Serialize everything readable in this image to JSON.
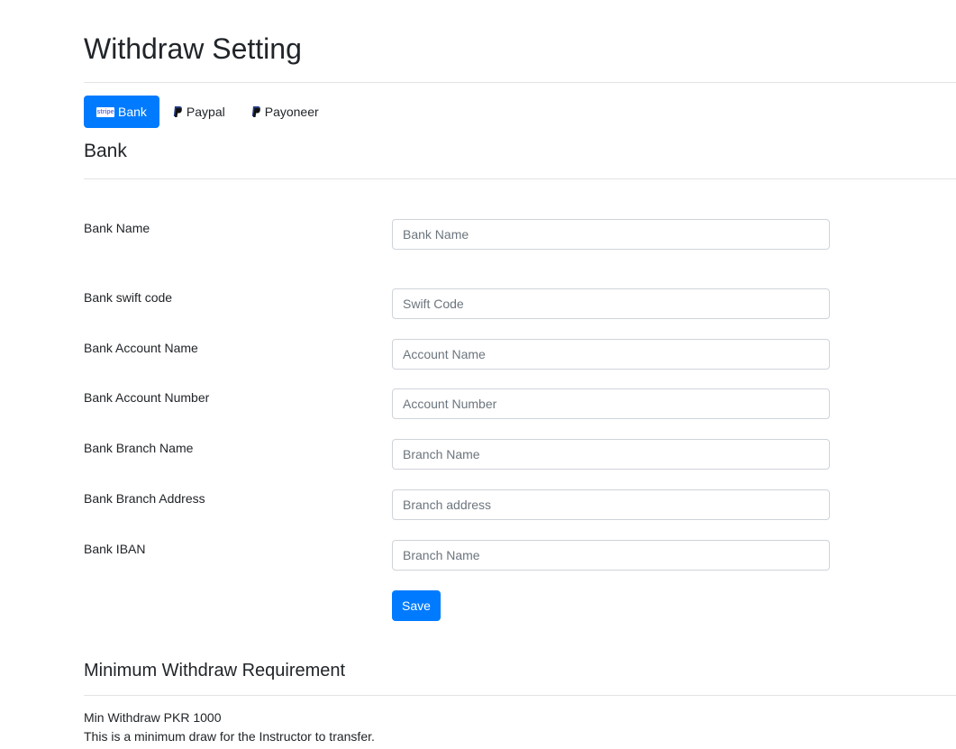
{
  "page": {
    "title": "Withdraw Setting"
  },
  "tabs": [
    {
      "label": "Bank",
      "icon": "stripe-icon",
      "active": true
    },
    {
      "label": "Paypal",
      "icon": "paypal-icon",
      "active": false
    },
    {
      "label": "Payoneer",
      "icon": "paypal-icon",
      "active": false
    }
  ],
  "stripe_badge": "stripe",
  "bank_section": {
    "title": "Bank",
    "fields": [
      {
        "label": "Bank Name",
        "placeholder": "Bank Name",
        "value": ""
      },
      {
        "label": "Bank swift code",
        "placeholder": "Swift Code",
        "value": ""
      },
      {
        "label": "Bank Account Name",
        "placeholder": "Account Name",
        "value": ""
      },
      {
        "label": "Bank Account Number",
        "placeholder": "Account Number",
        "value": ""
      },
      {
        "label": "Bank Branch Name",
        "placeholder": "Branch Name",
        "value": ""
      },
      {
        "label": "Bank Branch Address",
        "placeholder": "Branch address",
        "value": ""
      },
      {
        "label": "Bank IBAN",
        "placeholder": "Branch Name",
        "value": ""
      }
    ],
    "save_label": "Save"
  },
  "min_section": {
    "title": "Minimum Withdraw Requirement",
    "amount_line": "Min Withdraw PKR 1000",
    "description": "This is a minimum draw for the Instructor to transfer."
  },
  "colors": {
    "accent": "#007bff",
    "text": "#212529",
    "placeholder": "#6c757d",
    "border": "#ced4da"
  }
}
